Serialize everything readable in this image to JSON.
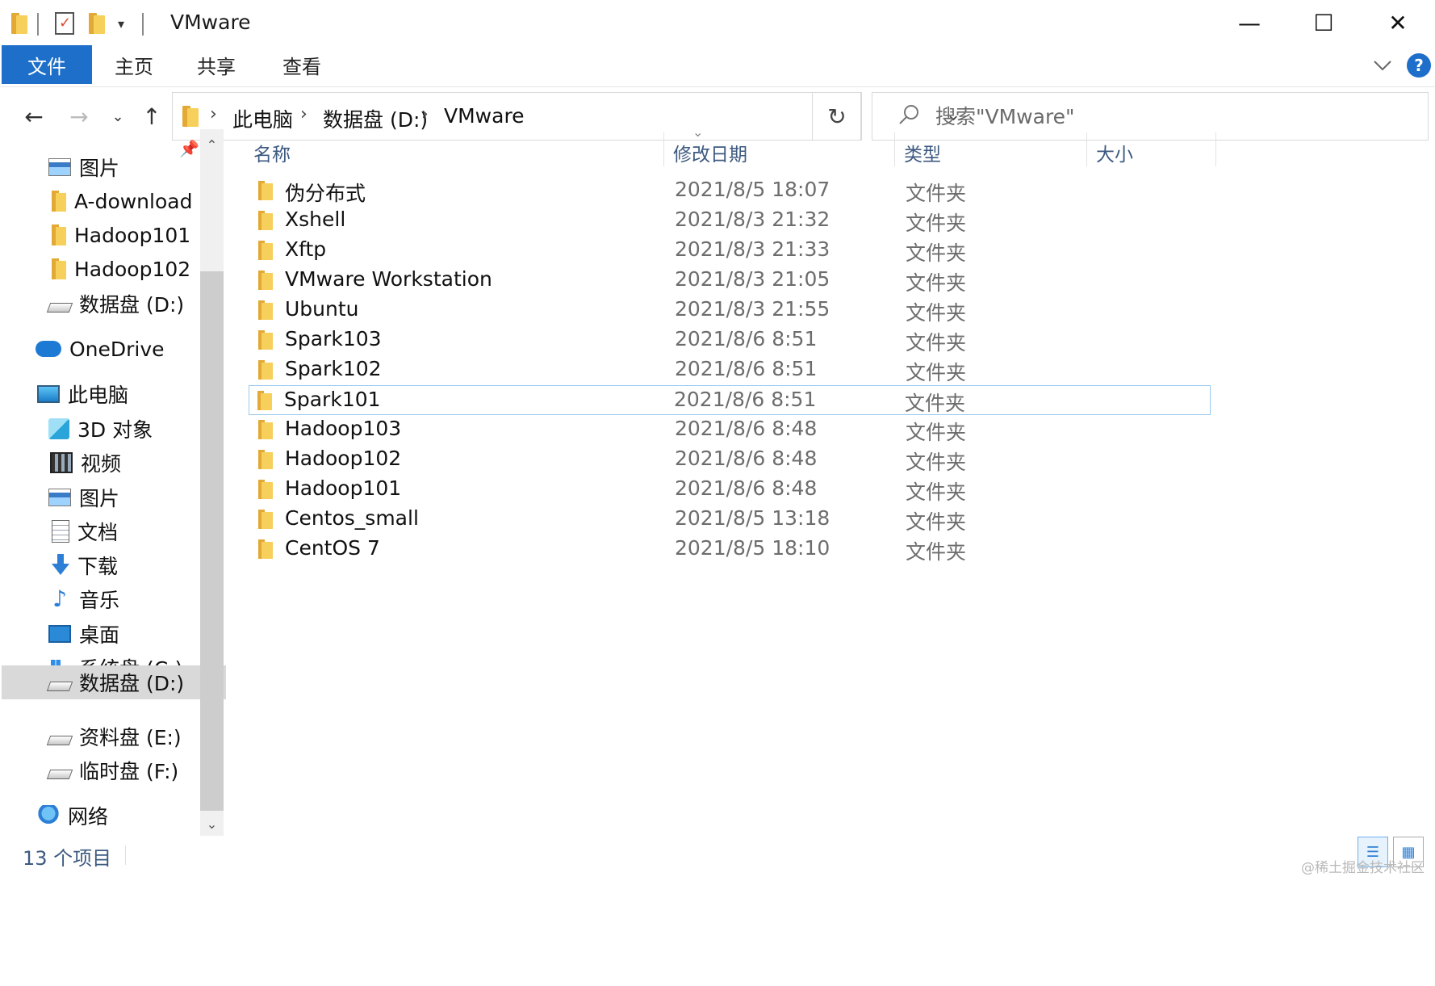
{
  "window": {
    "title": "VMware",
    "minimize_glyph": "—",
    "maximize_glyph": "☐",
    "close_glyph": "✕"
  },
  "ribbon": {
    "tabs": [
      "文件",
      "主页",
      "共享",
      "查看"
    ],
    "help_label": "?"
  },
  "address": {
    "crumbs": [
      "此电脑",
      "数据盘 (D:)",
      "VMware"
    ],
    "refresh_glyph": "↻"
  },
  "search": {
    "placeholder": "搜索\"VMware\""
  },
  "navigation": {
    "items": [
      {
        "label": "图片",
        "icon": "pictures-icon"
      },
      {
        "label": "A-download",
        "icon": "folder-icon"
      },
      {
        "label": "Hadoop101",
        "icon": "folder-icon"
      },
      {
        "label": "Hadoop102",
        "icon": "folder-icon"
      },
      {
        "label": "数据盘 (D:)",
        "icon": "drive-icon"
      },
      {
        "label": "OneDrive",
        "icon": "onedrive-icon"
      },
      {
        "label": "此电脑",
        "icon": "this-pc-icon"
      },
      {
        "label": "3D 对象",
        "icon": "3d-objects-icon"
      },
      {
        "label": "视频",
        "icon": "videos-icon"
      },
      {
        "label": "图片",
        "icon": "pictures-icon"
      },
      {
        "label": "文档",
        "icon": "documents-icon"
      },
      {
        "label": "下载",
        "icon": "downloads-icon"
      },
      {
        "label": "音乐",
        "icon": "music-icon"
      },
      {
        "label": "桌面",
        "icon": "desktop-icon"
      },
      {
        "label": "系统盘 (C:)",
        "icon": "system-drive-icon"
      },
      {
        "label": "数据盘 (D:)",
        "icon": "drive-icon"
      },
      {
        "label": "资料盘 (E:)",
        "icon": "drive-icon"
      },
      {
        "label": "临时盘 (F:)",
        "icon": "drive-icon"
      },
      {
        "label": "网络",
        "icon": "network-icon"
      }
    ],
    "selected_label": "数据盘 (D:)"
  },
  "columns": {
    "name": "名称",
    "modified": "修改日期",
    "type": "类型",
    "size": "大小"
  },
  "files": [
    {
      "name": "伪分布式",
      "modified": "2021/8/5 18:07",
      "type": "文件夹"
    },
    {
      "name": "Xshell",
      "modified": "2021/8/3 21:32",
      "type": "文件夹"
    },
    {
      "name": "Xftp",
      "modified": "2021/8/3 21:33",
      "type": "文件夹"
    },
    {
      "name": "VMware Workstation",
      "modified": "2021/8/3 21:05",
      "type": "文件夹"
    },
    {
      "name": "Ubuntu",
      "modified": "2021/8/3 21:55",
      "type": "文件夹"
    },
    {
      "name": "Spark103",
      "modified": "2021/8/6 8:51",
      "type": "文件夹"
    },
    {
      "name": "Spark102",
      "modified": "2021/8/6 8:51",
      "type": "文件夹"
    },
    {
      "name": "Spark101",
      "modified": "2021/8/6 8:51",
      "type": "文件夹"
    },
    {
      "name": "Hadoop103",
      "modified": "2021/8/6 8:48",
      "type": "文件夹"
    },
    {
      "name": "Hadoop102",
      "modified": "2021/8/6 8:48",
      "type": "文件夹"
    },
    {
      "name": "Hadoop101",
      "modified": "2021/8/6 8:48",
      "type": "文件夹"
    },
    {
      "name": "Centos_small",
      "modified": "2021/8/5 13:18",
      "type": "文件夹"
    },
    {
      "name": "CentOS 7",
      "modified": "2021/8/5 18:10",
      "type": "文件夹"
    }
  ],
  "selected_file": "Spark101",
  "status": {
    "count": "13 个项目"
  },
  "watermark": "@稀土掘金技术社区",
  "colors": {
    "accent": "#1d6fc9",
    "folder": "#f7cf5b",
    "selection_border": "#99c9ef",
    "nav_selected": "#d9d9d9",
    "header_text": "#3d5a80"
  }
}
